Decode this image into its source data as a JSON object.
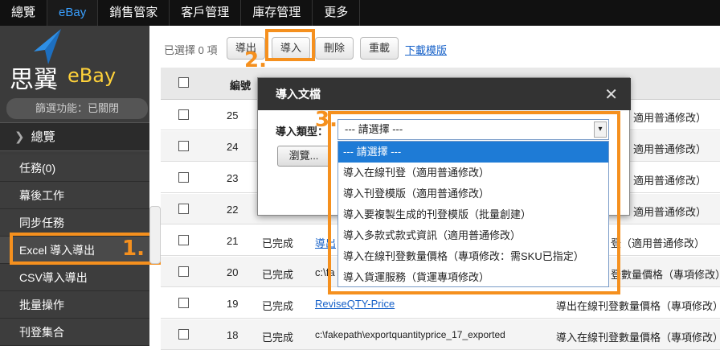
{
  "nav": [
    "總覽",
    "eBay",
    "銷售管家",
    "客戶管理",
    "庫存管理",
    "更多"
  ],
  "sidebar": {
    "logo_name": "思翼",
    "logo_brand": "eBay",
    "filter": "篩選功能：已關閉",
    "overview": "總覽",
    "items": [
      "任務(0)",
      "幕後工作",
      "同步任務",
      "Excel 導入導出",
      "CSV導入導出",
      "批量操作",
      "刊登集合"
    ]
  },
  "steps": {
    "one": "1.",
    "two": "2.",
    "three": "3."
  },
  "toolbar": {
    "selected": "已選擇 0 項",
    "export": "導出",
    "import": "導入",
    "delete": "刪除",
    "reload": "重載",
    "download_template": "下載模版"
  },
  "table": {
    "header_id": "編號",
    "rows": [
      {
        "id": "25",
        "status": "",
        "file": "",
        "type": "適用普通修改）"
      },
      {
        "id": "24",
        "status": "",
        "file": "",
        "type": "適用普通修改）"
      },
      {
        "id": "23",
        "status": "",
        "file": "",
        "type": "適用普通修改）"
      },
      {
        "id": "22",
        "status": "",
        "file": "",
        "type": "適用普通修改）"
      },
      {
        "id": "21",
        "status": "已完成",
        "file": "導出",
        "type": "登（適用普通修改）"
      },
      {
        "id": "20",
        "status": "已完成",
        "file": "c:\\fa",
        "type": "登數量價格（專項修改）"
      },
      {
        "id": "19",
        "status": "已完成",
        "file": "ReviseQTY-Price",
        "type": "導出在線刊登數量價格（專項修改）"
      },
      {
        "id": "18",
        "status": "已完成",
        "file": "c:\\fakepath\\exportquantityprice_17_exported",
        "type": "導入在線刊登數量價格（專項修改）"
      }
    ]
  },
  "modal": {
    "title": "導入文檔",
    "close": "✕",
    "type_label": "導入類型：",
    "browse": "瀏覽..."
  },
  "select": {
    "value": "--- 請選擇 ---",
    "options": [
      "--- 請選擇 ---",
      "導入在線刊登（適用普通修改）",
      "導入刊登模版（適用普通修改）",
      "導入要複製生成的刊登模版（批量創建）",
      "導入多款式款式資訊（適用普通修改）",
      "導入在線刊登數量價格（專項修改：需SKU已指定）",
      "導入貨運服務（貨運專項修改）"
    ]
  }
}
